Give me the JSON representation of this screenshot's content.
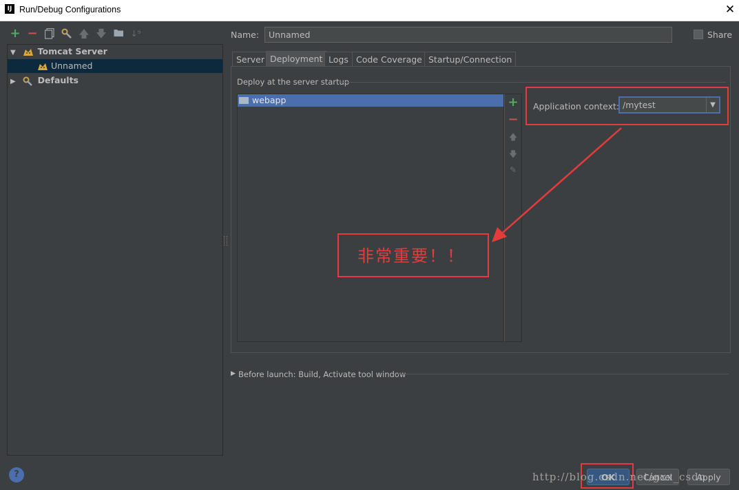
{
  "window": {
    "title": "Run/Debug Configurations",
    "app_icon": "IJ"
  },
  "toolbar": {
    "icons": [
      "add-icon",
      "remove-icon",
      "copy-icon",
      "wrench-icon",
      "move-up-icon",
      "move-down-icon",
      "folder-icon",
      "sort-icon"
    ]
  },
  "tree": {
    "items": [
      {
        "label": "Tomcat Server",
        "expanded": true
      },
      {
        "label": "Unnamed",
        "selected": true
      },
      {
        "label": "Defaults",
        "expanded": false
      }
    ]
  },
  "name_field": {
    "label": "Name:",
    "value": "Unnamed"
  },
  "share": {
    "label": "Share",
    "checked": false
  },
  "tabs": [
    {
      "label": "Server",
      "active": false
    },
    {
      "label": "Deployment",
      "active": true
    },
    {
      "label": "Logs",
      "active": false
    },
    {
      "label": "Code Coverage",
      "active": false
    },
    {
      "label": "Startup/Connection",
      "active": false
    }
  ],
  "deployment": {
    "section_label": "Deploy at the server startup",
    "artifacts": [
      "webapp"
    ],
    "app_context_label": "Application context:",
    "app_context_value": "/mytest"
  },
  "annotation": {
    "text": "非常重要！！",
    "color": "#e53b3b"
  },
  "before_launch": {
    "label": "Before launch: Build, Activate tool window"
  },
  "buttons": {
    "ok": "OK",
    "cancel": "Cancel",
    "apply": "Apply",
    "help": "?"
  },
  "watermark": "http://blog.csdn.net/gxx_csdn",
  "colors": {
    "background": "#3c3f41",
    "selection": "#4b6eaf",
    "tree_selection": "#0d293e",
    "accent_red": "#e53b3b",
    "add_green": "#59a869",
    "remove_red": "#c75450"
  }
}
